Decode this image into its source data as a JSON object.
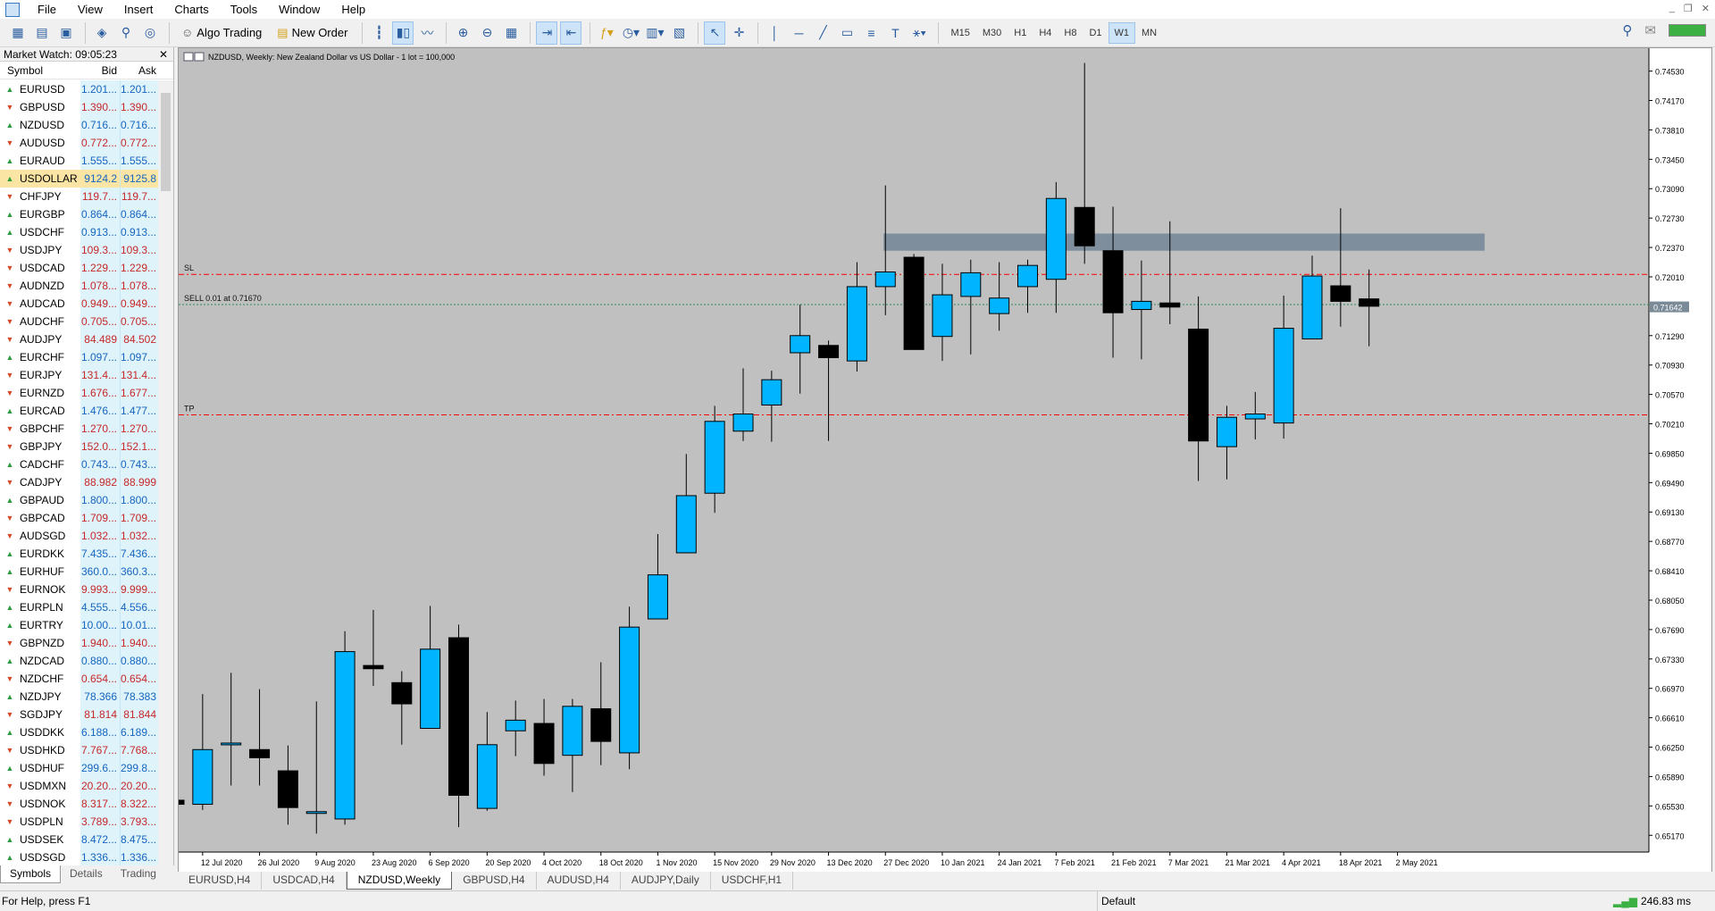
{
  "menu": [
    "File",
    "View",
    "Insert",
    "Charts",
    "Tools",
    "Window",
    "Help"
  ],
  "toolbar": {
    "algo_trading": "Algo Trading",
    "new_order": "New Order",
    "timeframes": [
      "M15",
      "M30",
      "H1",
      "H4",
      "H8",
      "D1",
      "W1",
      "MN"
    ],
    "active_timeframe": "W1"
  },
  "market_watch": {
    "title": "Market Watch: 09:05:23",
    "col_symbol": "Symbol",
    "col_bid": "Bid",
    "col_ask": "Ask",
    "rows": [
      {
        "s": "EURUSD",
        "b": "1.201...",
        "a": "1.201...",
        "d": "up"
      },
      {
        "s": "GBPUSD",
        "b": "1.390...",
        "a": "1.390...",
        "d": "dn"
      },
      {
        "s": "NZDUSD",
        "b": "0.716...",
        "a": "0.716...",
        "d": "up"
      },
      {
        "s": "AUDUSD",
        "b": "0.772...",
        "a": "0.772...",
        "d": "dn"
      },
      {
        "s": "EURAUD",
        "b": "1.555...",
        "a": "1.555...",
        "d": "up"
      },
      {
        "s": "USDOLLAR",
        "b": "9124.2",
        "a": "9125.8",
        "d": "up",
        "sel": true
      },
      {
        "s": "CHFJPY",
        "b": "119.7...",
        "a": "119.7...",
        "d": "dn"
      },
      {
        "s": "EURGBP",
        "b": "0.864...",
        "a": "0.864...",
        "d": "up"
      },
      {
        "s": "USDCHF",
        "b": "0.913...",
        "a": "0.913...",
        "d": "up"
      },
      {
        "s": "USDJPY",
        "b": "109.3...",
        "a": "109.3...",
        "d": "dn"
      },
      {
        "s": "USDCAD",
        "b": "1.229...",
        "a": "1.229...",
        "d": "dn"
      },
      {
        "s": "AUDNZD",
        "b": "1.078...",
        "a": "1.078...",
        "d": "dn"
      },
      {
        "s": "AUDCAD",
        "b": "0.949...",
        "a": "0.949...",
        "d": "dn"
      },
      {
        "s": "AUDCHF",
        "b": "0.705...",
        "a": "0.705...",
        "d": "dn"
      },
      {
        "s": "AUDJPY",
        "b": "84.489",
        "a": "84.502",
        "d": "dn"
      },
      {
        "s": "EURCHF",
        "b": "1.097...",
        "a": "1.097...",
        "d": "up"
      },
      {
        "s": "EURJPY",
        "b": "131.4...",
        "a": "131.4...",
        "d": "dn"
      },
      {
        "s": "EURNZD",
        "b": "1.676...",
        "a": "1.677...",
        "d": "dn"
      },
      {
        "s": "EURCAD",
        "b": "1.476...",
        "a": "1.477...",
        "d": "up"
      },
      {
        "s": "GBPCHF",
        "b": "1.270...",
        "a": "1.270...",
        "d": "dn"
      },
      {
        "s": "GBPJPY",
        "b": "152.0...",
        "a": "152.1...",
        "d": "dn"
      },
      {
        "s": "CADCHF",
        "b": "0.743...",
        "a": "0.743...",
        "d": "up"
      },
      {
        "s": "CADJPY",
        "b": "88.982",
        "a": "88.999",
        "d": "dn"
      },
      {
        "s": "GBPAUD",
        "b": "1.800...",
        "a": "1.800...",
        "d": "up"
      },
      {
        "s": "GBPCAD",
        "b": "1.709...",
        "a": "1.709...",
        "d": "dn"
      },
      {
        "s": "AUDSGD",
        "b": "1.032...",
        "a": "1.032...",
        "d": "dn"
      },
      {
        "s": "EURDKK",
        "b": "7.435...",
        "a": "7.436...",
        "d": "up"
      },
      {
        "s": "EURHUF",
        "b": "360.0...",
        "a": "360.3...",
        "d": "up"
      },
      {
        "s": "EURNOK",
        "b": "9.993...",
        "a": "9.999...",
        "d": "dn"
      },
      {
        "s": "EURPLN",
        "b": "4.555...",
        "a": "4.556...",
        "d": "up"
      },
      {
        "s": "EURTRY",
        "b": "10.00...",
        "a": "10.01...",
        "d": "up"
      },
      {
        "s": "GBPNZD",
        "b": "1.940...",
        "a": "1.940...",
        "d": "dn"
      },
      {
        "s": "NZDCAD",
        "b": "0.880...",
        "a": "0.880...",
        "d": "up"
      },
      {
        "s": "NZDCHF",
        "b": "0.654...",
        "a": "0.654...",
        "d": "dn"
      },
      {
        "s": "NZDJPY",
        "b": "78.366",
        "a": "78.383",
        "d": "up"
      },
      {
        "s": "SGDJPY",
        "b": "81.814",
        "a": "81.844",
        "d": "dn"
      },
      {
        "s": "USDDKK",
        "b": "6.188...",
        "a": "6.189...",
        "d": "up"
      },
      {
        "s": "USDHKD",
        "b": "7.767...",
        "a": "7.768...",
        "d": "dn"
      },
      {
        "s": "USDHUF",
        "b": "299.6...",
        "a": "299.8...",
        "d": "up"
      },
      {
        "s": "USDMXN",
        "b": "20.20...",
        "a": "20.20...",
        "d": "dn"
      },
      {
        "s": "USDNOK",
        "b": "8.317...",
        "a": "8.322...",
        "d": "dn"
      },
      {
        "s": "USDPLN",
        "b": "3.789...",
        "a": "3.793...",
        "d": "dn"
      },
      {
        "s": "USDSEK",
        "b": "8.472...",
        "a": "8.475...",
        "d": "up"
      },
      {
        "s": "USDSGD",
        "b": "1.336...",
        "a": "1.336...",
        "d": "up"
      }
    ],
    "tabs": [
      "Symbols",
      "Details",
      "Trading"
    ]
  },
  "chart_tabs": [
    "EURUSD,H4",
    "USDCAD,H4",
    "NZDUSD,Weekly",
    "GBPUSD,H4",
    "AUDUSD,H4",
    "AUDJPY,Daily",
    "USDCHF,H1"
  ],
  "active_chart_tab": "NZDUSD,Weekly",
  "status": {
    "help": "For Help, press F1",
    "profile": "Default",
    "ping": "246.83 ms"
  },
  "colors": {
    "bull": "#00b4ff",
    "bear": "#000000",
    "bg": "#c0c0c0",
    "stop": "#ff0000",
    "sell": "#2e8b57",
    "zone": "#778899"
  },
  "chart_data": {
    "type": "candlestick",
    "title": "NZDUSD, Weekly:  New Zealand Dollar vs US Dollar - 1 lot = 100,000",
    "ylim": [
      0.64965,
      0.7481
    ],
    "yticks": [
      "0.74530",
      "0.74170",
      "0.73810",
      "0.73450",
      "0.73090",
      "0.72730",
      "0.72370",
      "0.72010",
      "0.71290",
      "0.70930",
      "0.70570",
      "0.70210",
      "0.69850",
      "0.69490",
      "0.69130",
      "0.68770",
      "0.68410",
      "0.68050",
      "0.67690",
      "0.67330",
      "0.66970",
      "0.66610",
      "0.66250",
      "0.65890",
      "0.65530",
      "0.65170"
    ],
    "current_price": "0.71642",
    "xlabels": [
      {
        "t": "12 Jul 2020",
        "i": 1
      },
      {
        "t": "26 Jul 2020",
        "i": 3
      },
      {
        "t": "9 Aug 2020",
        "i": 5
      },
      {
        "t": "23 Aug 2020",
        "i": 7
      },
      {
        "t": "6 Sep 2020",
        "i": 9
      },
      {
        "t": "20 Sep 2020",
        "i": 11
      },
      {
        "t": "4 Oct 2020",
        "i": 13
      },
      {
        "t": "18 Oct 2020",
        "i": 15
      },
      {
        "t": "1 Nov 2020",
        "i": 17
      },
      {
        "t": "15 Nov 2020",
        "i": 19
      },
      {
        "t": "29 Nov 2020",
        "i": 21
      },
      {
        "t": "13 Dec 2020",
        "i": 23
      },
      {
        "t": "27 Dec 2020",
        "i": 25
      },
      {
        "t": "10 Jan 2021",
        "i": 27
      },
      {
        "t": "24 Jan 2021",
        "i": 29
      },
      {
        "t": "7 Feb 2021",
        "i": 31
      },
      {
        "t": "21 Feb 2021",
        "i": 33
      },
      {
        "t": "7 Mar 2021",
        "i": 35
      },
      {
        "t": "21 Mar 2021",
        "i": 37
      },
      {
        "t": "4 Apr 2021",
        "i": 39
      },
      {
        "t": "18 Apr 2021",
        "i": 41
      },
      {
        "t": "2 May 2021",
        "i": 43
      }
    ],
    "candles": [
      {
        "o": 0.656,
        "h": 0.656,
        "l": 0.6555,
        "c": 0.6555
      },
      {
        "o": 0.6555,
        "h": 0.669,
        "l": 0.6548,
        "c": 0.6622
      },
      {
        "o": 0.663,
        "h": 0.6716,
        "l": 0.6578,
        "c": 0.663
      },
      {
        "o": 0.6622,
        "h": 0.6696,
        "l": 0.6578,
        "c": 0.6612
      },
      {
        "o": 0.6596,
        "h": 0.6627,
        "l": 0.653,
        "c": 0.6551
      },
      {
        "o": 0.6546,
        "h": 0.6681,
        "l": 0.6519,
        "c": 0.6546
      },
      {
        "o": 0.6537,
        "h": 0.6767,
        "l": 0.653,
        "c": 0.6742
      },
      {
        "o": 0.6725,
        "h": 0.6793,
        "l": 0.67,
        "c": 0.6721
      },
      {
        "o": 0.6704,
        "h": 0.6718,
        "l": 0.6628,
        "c": 0.6678
      },
      {
        "o": 0.6648,
        "h": 0.6798,
        "l": 0.6648,
        "c": 0.6745
      },
      {
        "o": 0.6759,
        "h": 0.6775,
        "l": 0.6527,
        "c": 0.6566
      },
      {
        "o": 0.655,
        "h": 0.6668,
        "l": 0.6547,
        "c": 0.6628
      },
      {
        "o": 0.6645,
        "h": 0.6682,
        "l": 0.6614,
        "c": 0.6658
      },
      {
        "o": 0.6654,
        "h": 0.6684,
        "l": 0.659,
        "c": 0.6605
      },
      {
        "o": 0.6615,
        "h": 0.6684,
        "l": 0.657,
        "c": 0.6675
      },
      {
        "o": 0.6672,
        "h": 0.6729,
        "l": 0.6603,
        "c": 0.6632
      },
      {
        "o": 0.6618,
        "h": 0.6797,
        "l": 0.6598,
        "c": 0.6772
      },
      {
        "o": 0.6782,
        "h": 0.6886,
        "l": 0.6782,
        "c": 0.6836
      },
      {
        "o": 0.6863,
        "h": 0.6984,
        "l": 0.6863,
        "c": 0.6933
      },
      {
        "o": 0.6936,
        "h": 0.7043,
        "l": 0.6912,
        "c": 0.7024
      },
      {
        "o": 0.7012,
        "h": 0.7089,
        "l": 0.7,
        "c": 0.7033
      },
      {
        "o": 0.7044,
        "h": 0.7086,
        "l": 0.6999,
        "c": 0.7075
      },
      {
        "o": 0.7108,
        "h": 0.7167,
        "l": 0.7058,
        "c": 0.7129
      },
      {
        "o": 0.7117,
        "h": 0.7123,
        "l": 0.7,
        "c": 0.7102
      },
      {
        "o": 0.7098,
        "h": 0.7219,
        "l": 0.7085,
        "c": 0.7189
      },
      {
        "o": 0.7189,
        "h": 0.7313,
        "l": 0.7154,
        "c": 0.7207
      },
      {
        "o": 0.7225,
        "h": 0.7229,
        "l": 0.7112,
        "c": 0.7112
      },
      {
        "o": 0.7128,
        "h": 0.7217,
        "l": 0.7098,
        "c": 0.7179
      },
      {
        "o": 0.7177,
        "h": 0.7222,
        "l": 0.7106,
        "c": 0.7206
      },
      {
        "o": 0.7156,
        "h": 0.7219,
        "l": 0.7135,
        "c": 0.7175
      },
      {
        "o": 0.7189,
        "h": 0.7222,
        "l": 0.7157,
        "c": 0.7215
      },
      {
        "o": 0.7198,
        "h": 0.7317,
        "l": 0.7157,
        "c": 0.7297
      },
      {
        "o": 0.7286,
        "h": 0.7463,
        "l": 0.7217,
        "c": 0.7239
      },
      {
        "o": 0.7233,
        "h": 0.7287,
        "l": 0.7102,
        "c": 0.7157
      },
      {
        "o": 0.7161,
        "h": 0.7221,
        "l": 0.71,
        "c": 0.7171
      },
      {
        "o": 0.7169,
        "h": 0.7269,
        "l": 0.7143,
        "c": 0.7164
      },
      {
        "o": 0.7137,
        "h": 0.7177,
        "l": 0.6951,
        "c": 0.7
      },
      {
        "o": 0.6993,
        "h": 0.7043,
        "l": 0.6953,
        "c": 0.7029
      },
      {
        "o": 0.7027,
        "h": 0.706,
        "l": 0.7002,
        "c": 0.7033
      },
      {
        "o": 0.7022,
        "h": 0.7178,
        "l": 0.7003,
        "c": 0.7138
      },
      {
        "o": 0.7125,
        "h": 0.7227,
        "l": 0.7125,
        "c": 0.7202
      },
      {
        "o": 0.719,
        "h": 0.7285,
        "l": 0.714,
        "c": 0.7171
      },
      {
        "o": 0.7174,
        "h": 0.721,
        "l": 0.7116,
        "c": 0.7165
      }
    ],
    "lines": [
      {
        "label": "SL",
        "price": 0.7204,
        "color": "#ff0000"
      },
      {
        "label": "SELL 0.01 at 0.71670",
        "price": 0.7167,
        "color": "#2e8b57"
      },
      {
        "label": "TP",
        "price": 0.7032,
        "color": "#ff0000"
      }
    ],
    "zone": {
      "top": 0.7254,
      "bottom": 0.7233,
      "from": 25,
      "to": 46
    }
  }
}
